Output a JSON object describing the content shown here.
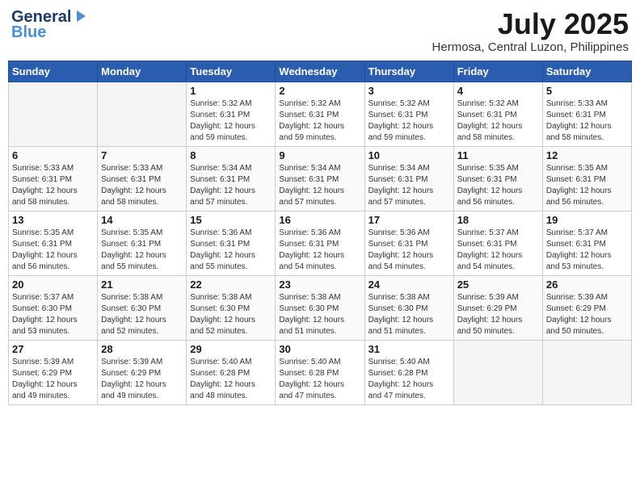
{
  "header": {
    "logo_general": "General",
    "logo_blue": "Blue",
    "month_year": "July 2025",
    "location": "Hermosa, Central Luzon, Philippines"
  },
  "calendar": {
    "days_of_week": [
      "Sunday",
      "Monday",
      "Tuesday",
      "Wednesday",
      "Thursday",
      "Friday",
      "Saturday"
    ],
    "weeks": [
      [
        {
          "day": "",
          "info": ""
        },
        {
          "day": "",
          "info": ""
        },
        {
          "day": "1",
          "info": "Sunrise: 5:32 AM\nSunset: 6:31 PM\nDaylight: 12 hours\nand 59 minutes."
        },
        {
          "day": "2",
          "info": "Sunrise: 5:32 AM\nSunset: 6:31 PM\nDaylight: 12 hours\nand 59 minutes."
        },
        {
          "day": "3",
          "info": "Sunrise: 5:32 AM\nSunset: 6:31 PM\nDaylight: 12 hours\nand 59 minutes."
        },
        {
          "day": "4",
          "info": "Sunrise: 5:32 AM\nSunset: 6:31 PM\nDaylight: 12 hours\nand 58 minutes."
        },
        {
          "day": "5",
          "info": "Sunrise: 5:33 AM\nSunset: 6:31 PM\nDaylight: 12 hours\nand 58 minutes."
        }
      ],
      [
        {
          "day": "6",
          "info": "Sunrise: 5:33 AM\nSunset: 6:31 PM\nDaylight: 12 hours\nand 58 minutes."
        },
        {
          "day": "7",
          "info": "Sunrise: 5:33 AM\nSunset: 6:31 PM\nDaylight: 12 hours\nand 58 minutes."
        },
        {
          "day": "8",
          "info": "Sunrise: 5:34 AM\nSunset: 6:31 PM\nDaylight: 12 hours\nand 57 minutes."
        },
        {
          "day": "9",
          "info": "Sunrise: 5:34 AM\nSunset: 6:31 PM\nDaylight: 12 hours\nand 57 minutes."
        },
        {
          "day": "10",
          "info": "Sunrise: 5:34 AM\nSunset: 6:31 PM\nDaylight: 12 hours\nand 57 minutes."
        },
        {
          "day": "11",
          "info": "Sunrise: 5:35 AM\nSunset: 6:31 PM\nDaylight: 12 hours\nand 56 minutes."
        },
        {
          "day": "12",
          "info": "Sunrise: 5:35 AM\nSunset: 6:31 PM\nDaylight: 12 hours\nand 56 minutes."
        }
      ],
      [
        {
          "day": "13",
          "info": "Sunrise: 5:35 AM\nSunset: 6:31 PM\nDaylight: 12 hours\nand 56 minutes."
        },
        {
          "day": "14",
          "info": "Sunrise: 5:35 AM\nSunset: 6:31 PM\nDaylight: 12 hours\nand 55 minutes."
        },
        {
          "day": "15",
          "info": "Sunrise: 5:36 AM\nSunset: 6:31 PM\nDaylight: 12 hours\nand 55 minutes."
        },
        {
          "day": "16",
          "info": "Sunrise: 5:36 AM\nSunset: 6:31 PM\nDaylight: 12 hours\nand 54 minutes."
        },
        {
          "day": "17",
          "info": "Sunrise: 5:36 AM\nSunset: 6:31 PM\nDaylight: 12 hours\nand 54 minutes."
        },
        {
          "day": "18",
          "info": "Sunrise: 5:37 AM\nSunset: 6:31 PM\nDaylight: 12 hours\nand 54 minutes."
        },
        {
          "day": "19",
          "info": "Sunrise: 5:37 AM\nSunset: 6:31 PM\nDaylight: 12 hours\nand 53 minutes."
        }
      ],
      [
        {
          "day": "20",
          "info": "Sunrise: 5:37 AM\nSunset: 6:30 PM\nDaylight: 12 hours\nand 53 minutes."
        },
        {
          "day": "21",
          "info": "Sunrise: 5:38 AM\nSunset: 6:30 PM\nDaylight: 12 hours\nand 52 minutes."
        },
        {
          "day": "22",
          "info": "Sunrise: 5:38 AM\nSunset: 6:30 PM\nDaylight: 12 hours\nand 52 minutes."
        },
        {
          "day": "23",
          "info": "Sunrise: 5:38 AM\nSunset: 6:30 PM\nDaylight: 12 hours\nand 51 minutes."
        },
        {
          "day": "24",
          "info": "Sunrise: 5:38 AM\nSunset: 6:30 PM\nDaylight: 12 hours\nand 51 minutes."
        },
        {
          "day": "25",
          "info": "Sunrise: 5:39 AM\nSunset: 6:29 PM\nDaylight: 12 hours\nand 50 minutes."
        },
        {
          "day": "26",
          "info": "Sunrise: 5:39 AM\nSunset: 6:29 PM\nDaylight: 12 hours\nand 50 minutes."
        }
      ],
      [
        {
          "day": "27",
          "info": "Sunrise: 5:39 AM\nSunset: 6:29 PM\nDaylight: 12 hours\nand 49 minutes."
        },
        {
          "day": "28",
          "info": "Sunrise: 5:39 AM\nSunset: 6:29 PM\nDaylight: 12 hours\nand 49 minutes."
        },
        {
          "day": "29",
          "info": "Sunrise: 5:40 AM\nSunset: 6:28 PM\nDaylight: 12 hours\nand 48 minutes."
        },
        {
          "day": "30",
          "info": "Sunrise: 5:40 AM\nSunset: 6:28 PM\nDaylight: 12 hours\nand 47 minutes."
        },
        {
          "day": "31",
          "info": "Sunrise: 5:40 AM\nSunset: 6:28 PM\nDaylight: 12 hours\nand 47 minutes."
        },
        {
          "day": "",
          "info": ""
        },
        {
          "day": "",
          "info": ""
        }
      ]
    ]
  }
}
